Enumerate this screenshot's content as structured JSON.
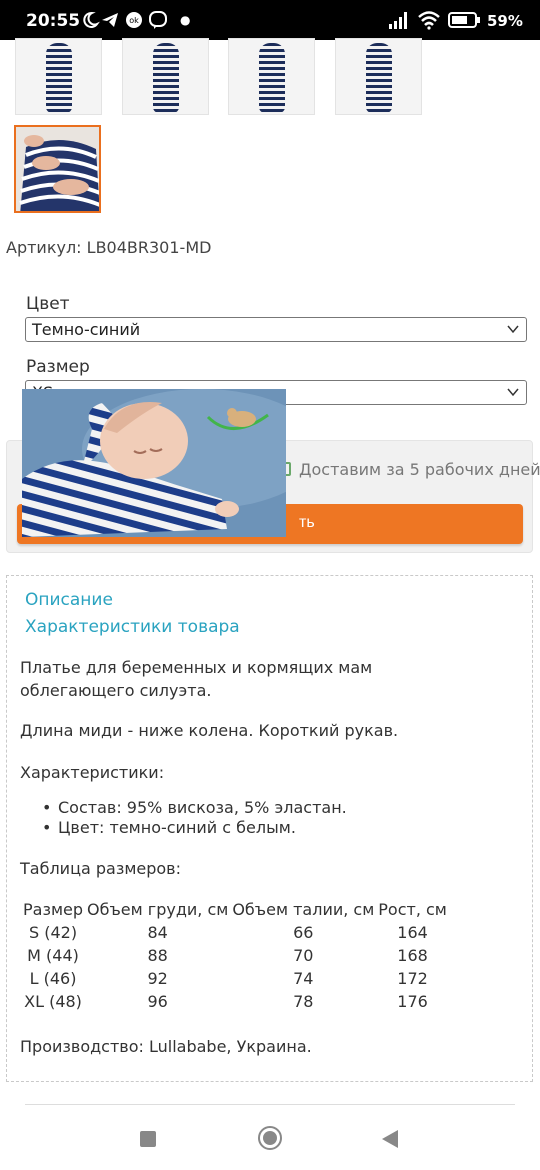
{
  "status_bar": {
    "time": "20:55",
    "battery_percent": "59%",
    "icons": [
      "moon-icon",
      "telegram-icon",
      "ok-icon",
      "viber-icon",
      "signal-icon",
      "wifi-icon",
      "battery-icon"
    ]
  },
  "gallery": {
    "thumbnails": [
      "thumb-1",
      "thumb-2",
      "thumb-3",
      "thumb-4",
      "thumb-5"
    ],
    "selected_index": 4,
    "accent_color": "#ea6f1e"
  },
  "product": {
    "sku": "Артикул: LB04BR301-MD",
    "color_label": "Цвет",
    "color_value": "Темно-синий",
    "size_label": "Размер",
    "size_value": "XS"
  },
  "buy": {
    "delivery_text": "Доставим за 5 рабочих дней",
    "button_visible_text": "ть",
    "button_color": "#ee7623"
  },
  "description": {
    "tab_description": "Описание",
    "tab_characteristics": "Характеристики товара",
    "paragraph1": "Платье для беременных и кормящих мам облегающего силуэта.",
    "paragraph2": "Длина миди - ниже колена. Короткий рукав.",
    "characteristics_heading": "Характеристики:",
    "bullets": [
      "Состав: 95% вискоза, 5% эластан.",
      "Цвет: темно-синий с белым."
    ],
    "size_table_heading": "Таблица размеров:",
    "size_table": {
      "headers": [
        "Размер",
        "Объем груди, см",
        "Объем талии, см",
        "Рост, см"
      ],
      "rows": [
        [
          "S (42)",
          "84",
          "66",
          "164"
        ],
        [
          "M (44)",
          "88",
          "70",
          "168"
        ],
        [
          "L (46)",
          "92",
          "74",
          "172"
        ],
        [
          "XL (48)",
          "96",
          "78",
          "176"
        ]
      ]
    },
    "production": "Производство: Lullababe, Украина."
  },
  "nav_bar": {
    "icons": [
      "recent-apps-icon",
      "home-icon",
      "back-icon"
    ]
  }
}
